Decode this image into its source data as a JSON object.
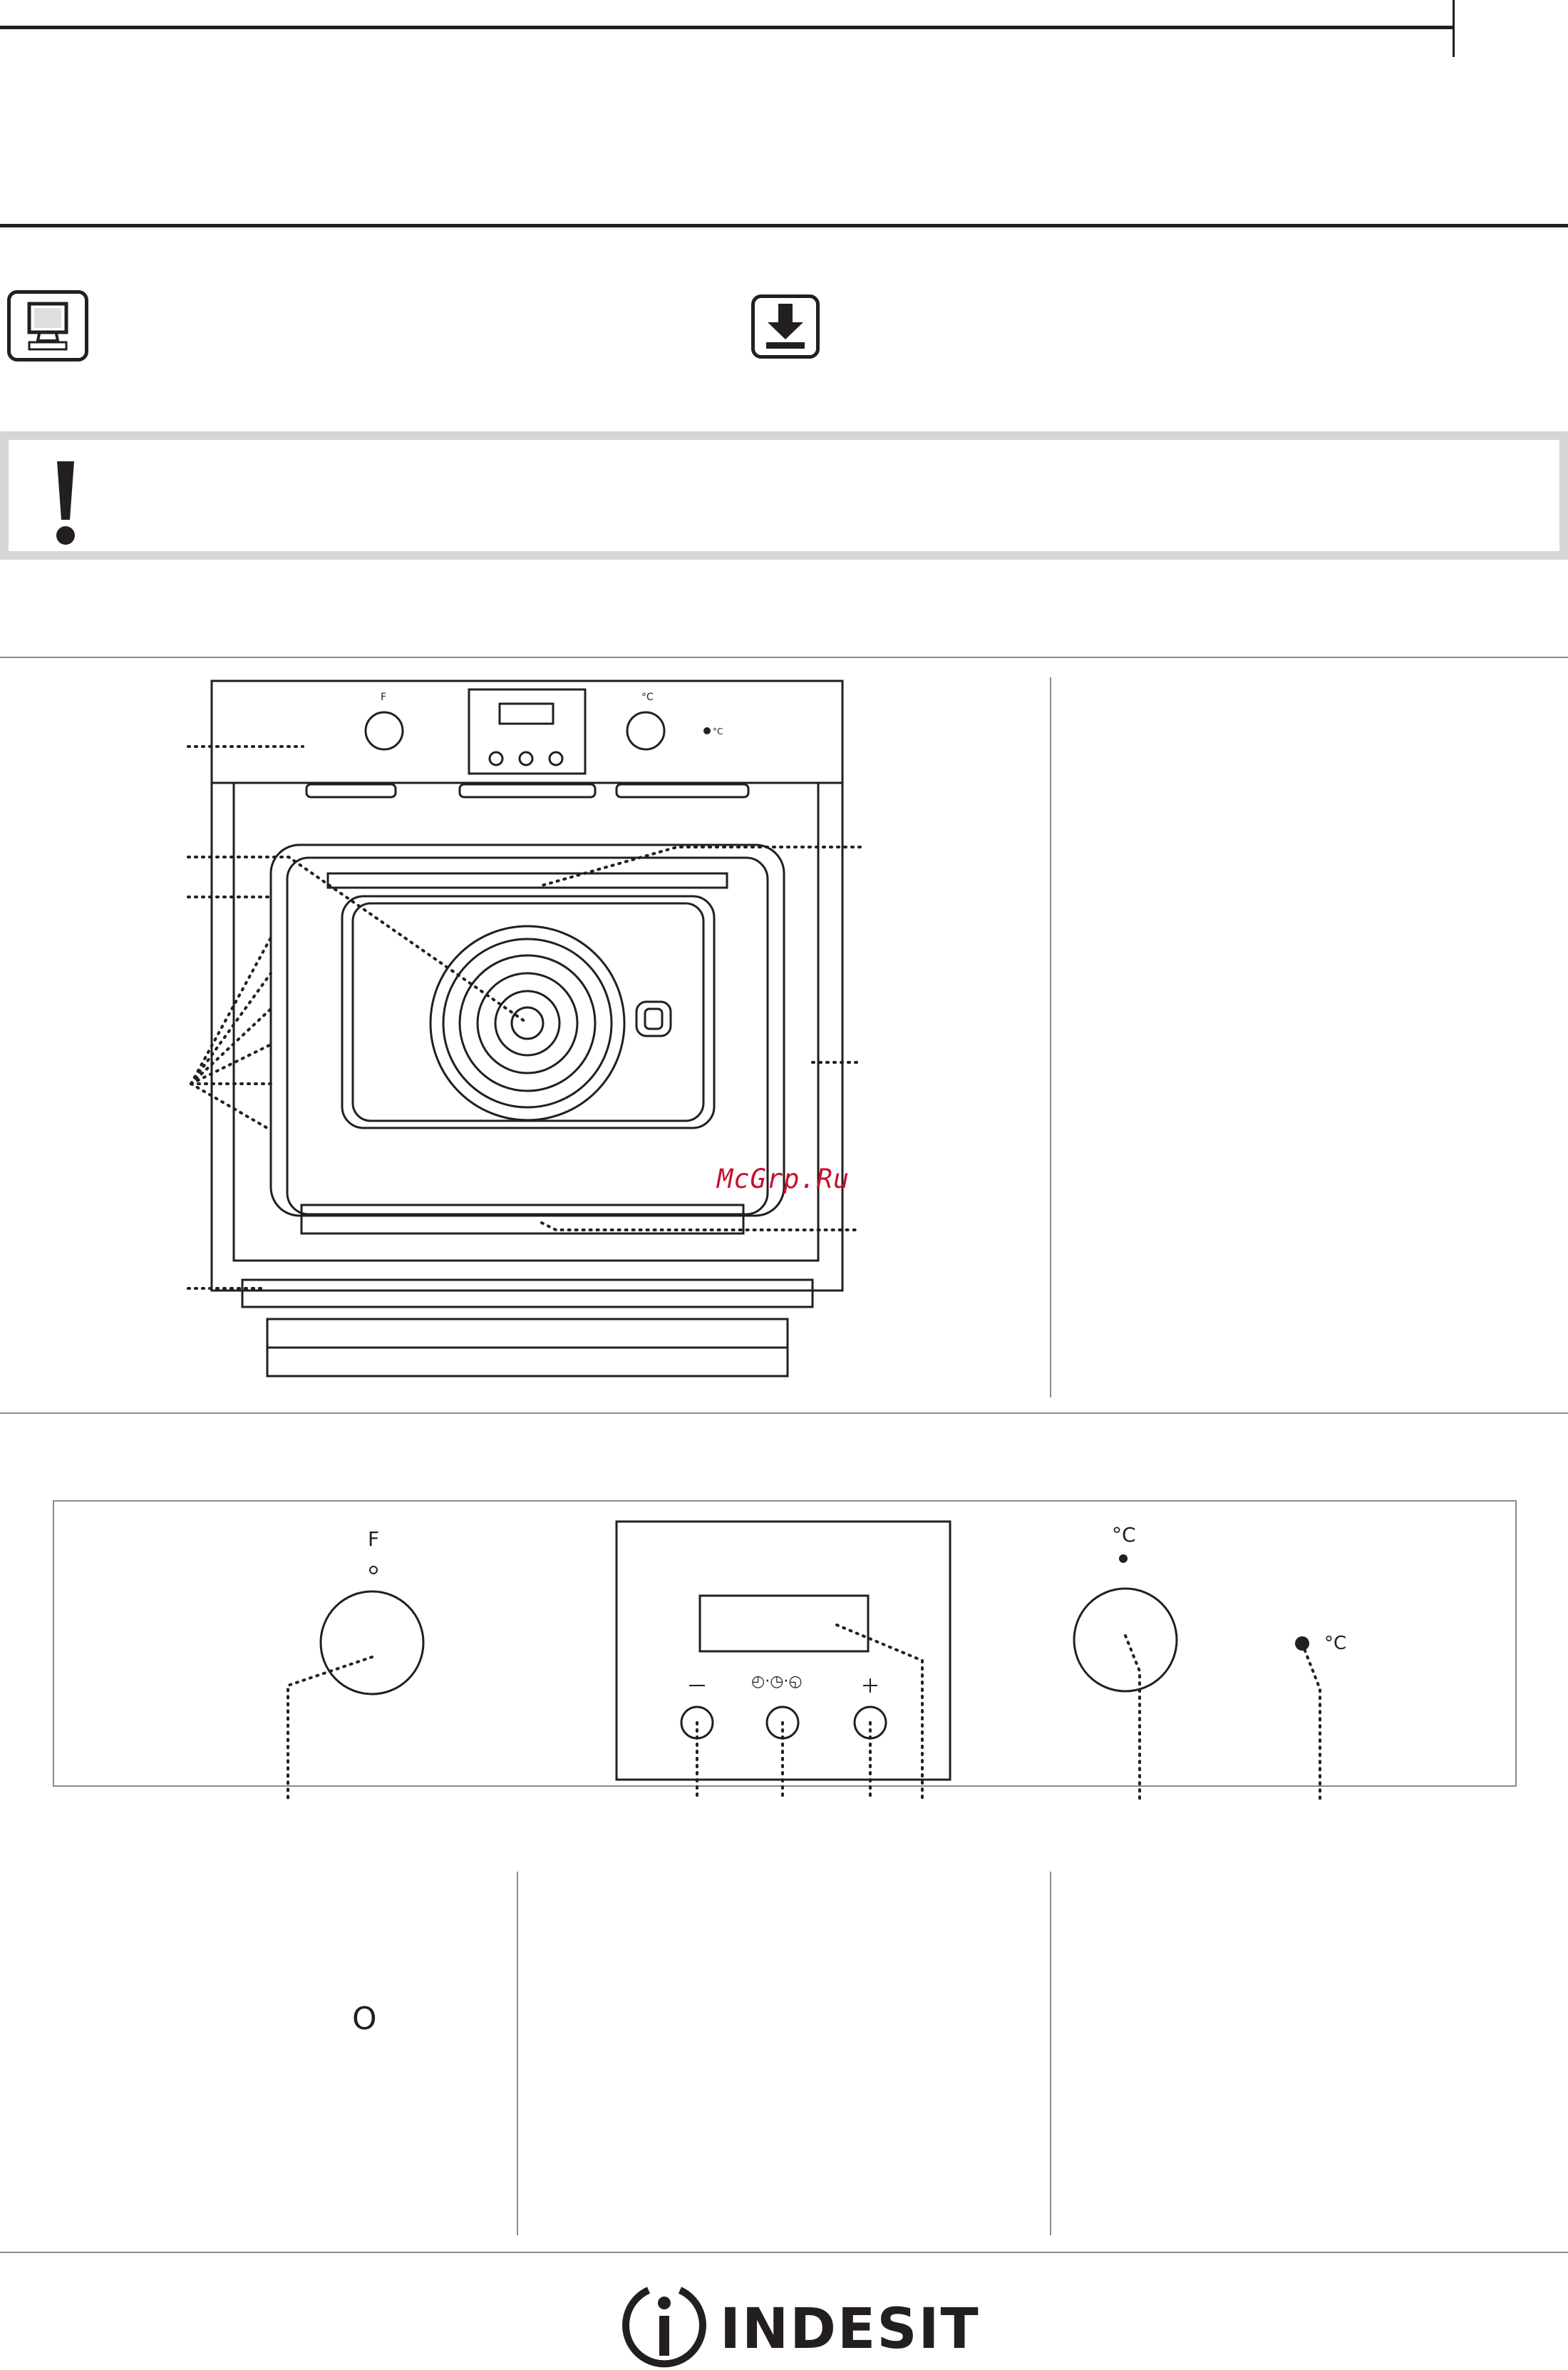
{
  "icons": {
    "left": "monitor-icon",
    "right": "download-icon",
    "warning": "exclamation-icon"
  },
  "oven_diagram": {
    "control_labels": {
      "function_knob": "F",
      "thermostat_knob": "°C",
      "thermostat_light": "°C",
      "display_buttons": [
        "–",
        "◴·◷·◵",
        "+"
      ]
    }
  },
  "watermark": "McGrp.Ru",
  "control_panel": {
    "function_knob_label": "F",
    "thermostat_knob_label": "°C",
    "thermostat_light_label": "°C",
    "minus_label": "–",
    "clock_label": "◴·◷·◵",
    "plus_label": "+"
  },
  "footer_columns": {
    "off_symbol": "O"
  },
  "brand": {
    "name": "INDESIT"
  },
  "colors": {
    "ink": "#231f20",
    "warning_border": "#d6d6d6",
    "watermark": "#c8102e"
  }
}
